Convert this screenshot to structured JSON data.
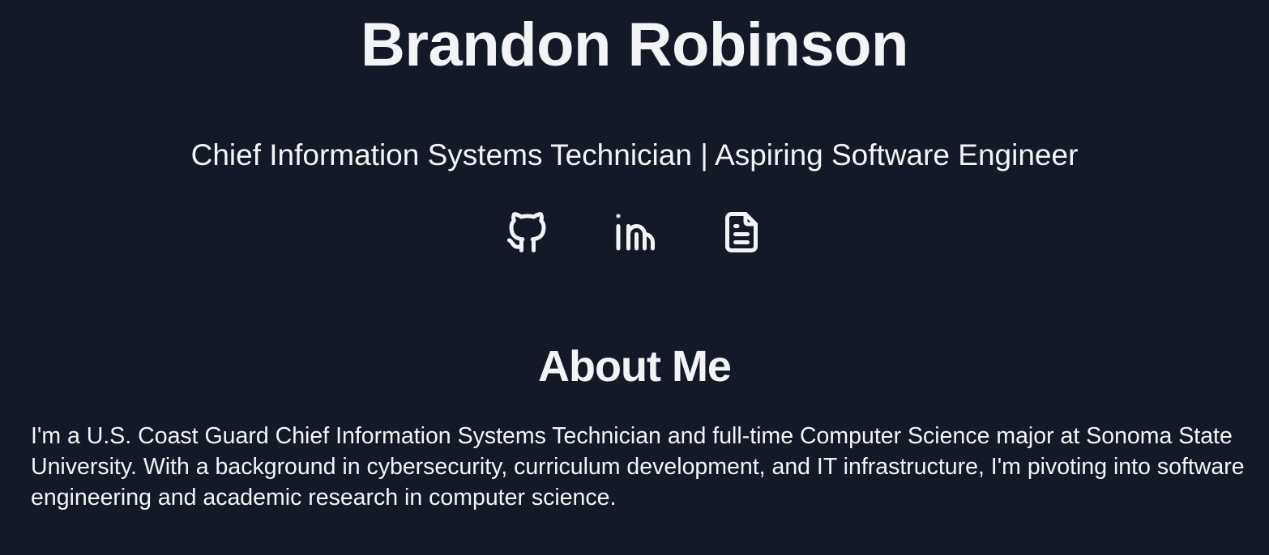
{
  "header": {
    "name": "Brandon Robinson",
    "tagline": "Chief Information Systems Technician | Aspiring Software Engineer"
  },
  "socials": [
    {
      "icon": "github-icon"
    },
    {
      "icon": "linkedin-icon"
    },
    {
      "icon": "file-text-icon"
    }
  ],
  "about": {
    "title": "About Me",
    "text": "I'm a U.S. Coast Guard Chief Information Systems Technician and full-time Computer Science major at Sonoma State University. With a background in cybersecurity, curriculum development, and IT infrastructure, I'm pivoting into software engineering and academic research in computer science."
  },
  "colors": {
    "background": "#131927",
    "text": "#f3f4f6"
  }
}
